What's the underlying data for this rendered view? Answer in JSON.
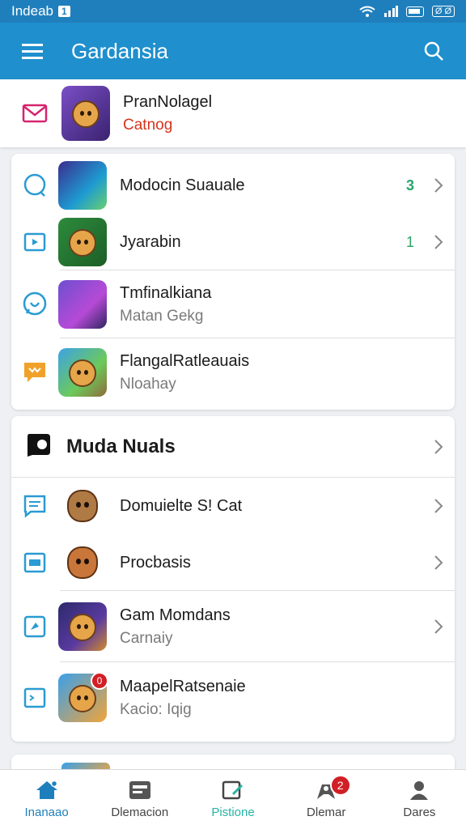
{
  "status_bar": {
    "carrier": "Indeab",
    "badge": "1",
    "indicator": "Ø Ø"
  },
  "app_bar": {
    "title": "Gardansia",
    "menu_icon": "menu-icon",
    "search_icon": "search-icon"
  },
  "top_item": {
    "title": "PranNolagel",
    "subtitle": "Catnog",
    "subtitle_color": "#d4341e",
    "lead_icon": "mail-icon"
  },
  "list_one": [
    {
      "title": "Modocin Suauale",
      "count": "3",
      "lead_icon": "chat-bubble-icon"
    },
    {
      "title": "Jyarabin",
      "count": "1",
      "lead_icon": "play-icon"
    },
    {
      "title": "Tmfinalkiana",
      "subtitle": "Matan Gekg",
      "lead_icon": "whatsapp-icon"
    },
    {
      "title": "FlangalRatleauais",
      "subtitle": "Nloahay",
      "lead_icon": "store-icon"
    }
  ],
  "section": {
    "title": "Muda Nuals",
    "lead_icon": "app-logo-icon"
  },
  "list_two": [
    {
      "title": "Domuielte S! Cat",
      "lead_icon": "message-icon"
    },
    {
      "title": "Procbasis",
      "lead_icon": "window-icon"
    },
    {
      "title": "Gam Momdans",
      "subtitle": "Carnaiy",
      "lead_icon": "tag-icon"
    },
    {
      "title": "MaapelRatsenaie",
      "subtitle": "Kacio: Iqig",
      "badge": "0",
      "lead_icon": "terminal-icon"
    }
  ],
  "bottom_nav": [
    {
      "label": "Inanaao",
      "icon": "home-icon"
    },
    {
      "label": "Dlemacion",
      "icon": "gallery-icon"
    },
    {
      "label": "Pistione",
      "icon": "edit-icon"
    },
    {
      "label": "Dlemar",
      "icon": "game-icon",
      "badge": "2"
    },
    {
      "label": "Dares",
      "icon": "person-icon"
    }
  ],
  "colors": {
    "primary": "#1f8fcd",
    "accent_green": "#2aa56a",
    "badge_red": "#d21f26"
  }
}
